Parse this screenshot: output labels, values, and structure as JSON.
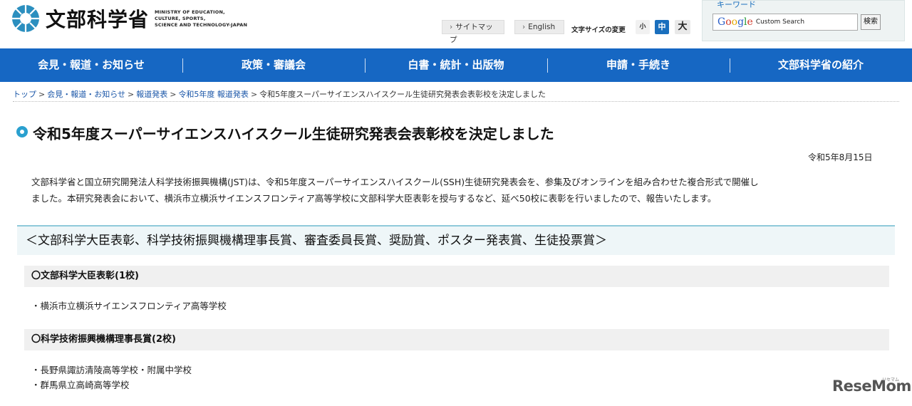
{
  "header": {
    "logo_text": "文部科学省",
    "logo_en": [
      "MINISTRY OF EDUCATION,",
      "CULTURE, SPORTS,",
      "SCIENCE AND TECHNOLOGY-JAPAN"
    ],
    "sitemap_label": "サイトマップ",
    "english_label": "English",
    "font_size_label": "文字サイズの変更",
    "font_sizes": [
      "小",
      "中",
      "大"
    ],
    "search": {
      "keyword_label": "キーワード",
      "placeholder": "Custom Search",
      "button_label": "検索"
    }
  },
  "nav": {
    "items": [
      "会見・報道・お知らせ",
      "政策・審議会",
      "白書・統計・出版物",
      "申請・手続き",
      "文部科学省の紹介"
    ]
  },
  "breadcrumb": {
    "links": [
      "トップ",
      "会見・報道・お知らせ",
      "報道発表",
      "令和5年度 報道発表"
    ],
    "current": "令和5年度スーパーサイエンスハイスクール生徒研究発表会表彰校を決定しました"
  },
  "article": {
    "title": "令和5年度スーパーサイエンスハイスクール生徒研究発表会表彰校を決定しました",
    "date": "令和5年8月15日",
    "body_line1": "文部科学省と国立研究開発法人科学技術振興機構(JST)は、令和5年度スーパーサイエンスハイスクール(SSH)生徒研究発表会を、参集及びオンラインを組み合わせた複合形式で開催し",
    "body_line2": "ました。本研究発表会において、横浜市立横浜サイエンスフロンティア高等学校に文部科学大臣表彰を授与するなど、延べ50校に表彰を行いましたので、報告いたします。",
    "section_heading": "＜文部科学大臣表彰、科学技術振興機構理事長賞、審査委員長賞、奨励賞、ポスター発表賞、生徒投票賞＞",
    "awards": [
      {
        "title": "〇文部科学大臣表彰(1校)",
        "schools": [
          "・横浜市立横浜サイエンスフロンティア高等学校"
        ]
      },
      {
        "title": "〇科学技術振興機構理事長賞(2校)",
        "schools": [
          "・長野県諏訪清陵高等学校・附属中学校",
          "・群馬県立高崎高等学校"
        ]
      }
    ]
  },
  "watermark": {
    "text": "ReseMom",
    "sub": "リセマム"
  },
  "colors": {
    "nav_bg": "#1667c3",
    "accent_bullet": "#2aa0cf",
    "link": "#1a56a8"
  }
}
